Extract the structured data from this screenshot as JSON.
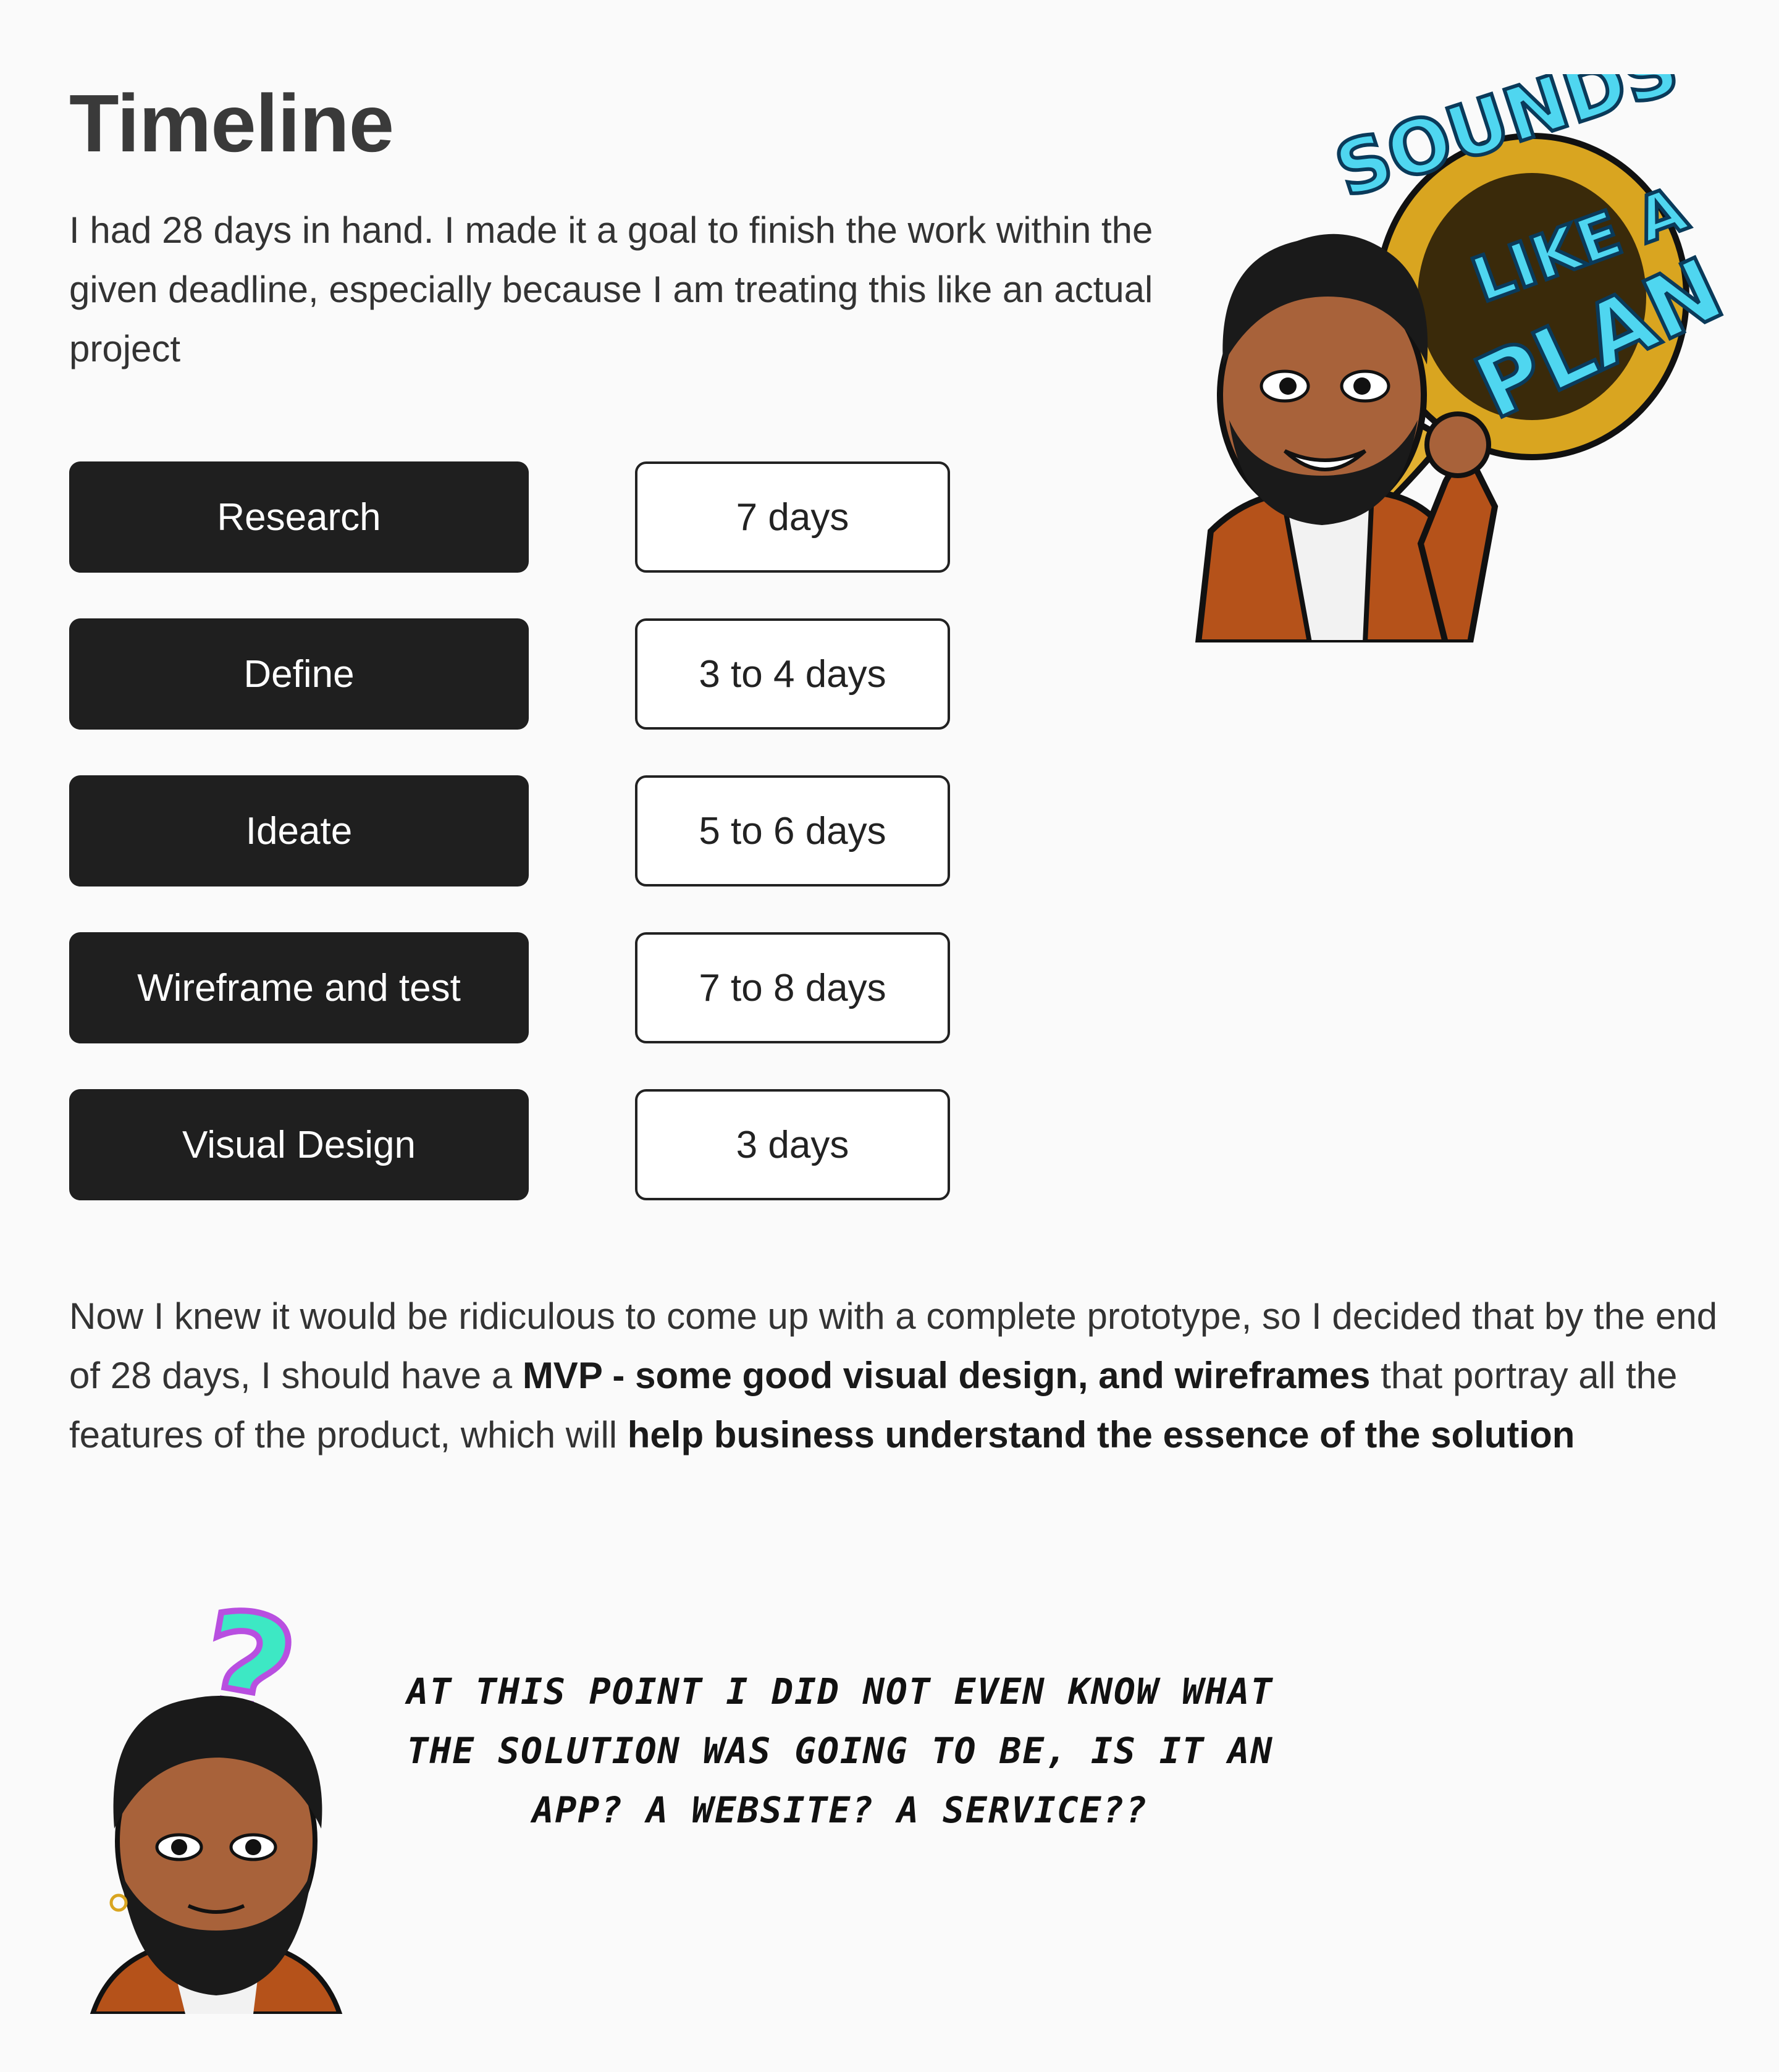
{
  "title": "Timeline",
  "intro": "I had 28 days in hand. I made it a goal to finish the work within the given deadline, especially because I am treating this like an actual project",
  "phases": [
    {
      "name": "Research",
      "duration": "7 days"
    },
    {
      "name": "Define",
      "duration": "3 to 4 days"
    },
    {
      "name": "Ideate",
      "duration": "5 to 6 days"
    },
    {
      "name": "Wireframe and test",
      "duration": "7 to 8 days"
    },
    {
      "name": "Visual Design",
      "duration": "3 days"
    }
  ],
  "para2": {
    "p1": "Now I knew it would be ridiculous to come up with a complete prototype, so I decided that by the end of 28 days, I should have a ",
    "b1": "MVP - some good visual design, and wireframes",
    "p2": " that portray all the features of the product, which will ",
    "b2": "help business understand the essence of the solution"
  },
  "sticker": {
    "line1": "SOUNDS",
    "line2": "LIKE A",
    "line3": "PLAN"
  },
  "comic_text": "At this point I did not even know what the solution was going to be, is it an app? A website? A service??",
  "question_mark": "?",
  "colors": {
    "dark_button": "#1f1f1f",
    "sticker_cyan": "#4fd6f0",
    "sticker_gold": "#d9a520",
    "question_purple": "#b84fe0",
    "question_teal": "#3de8c4",
    "skin": "#a8623a",
    "hoodie": "#b5521a"
  }
}
